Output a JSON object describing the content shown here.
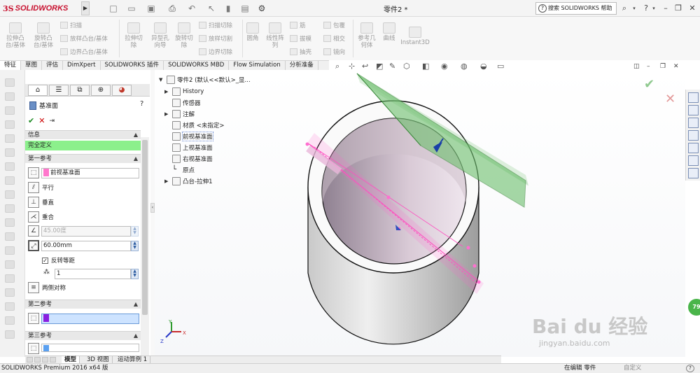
{
  "app": {
    "logo_text": "SOLIDWORKS",
    "logo_mark": "3S",
    "document_title": "零件2 *",
    "help_search": "搜索 SOLIDWORKS 帮助"
  },
  "ribbon": {
    "buttons": [
      {
        "label": "拉伸凸\n台/基体"
      },
      {
        "label": "旋转凸\n台/基体"
      },
      {
        "label": "拉伸切\n除"
      },
      {
        "label": "异型孔\n向导"
      },
      {
        "label": "旋转切\n除"
      },
      {
        "label": "圆角"
      },
      {
        "label": "线性阵\n列"
      },
      {
        "label": "参考几\n何体"
      },
      {
        "label": "曲线"
      },
      {
        "label": "Instant3D"
      }
    ],
    "small": [
      {
        "label": "扫描"
      },
      {
        "label": "放样凸台/基体"
      },
      {
        "label": "边界凸台/基体"
      },
      {
        "label": "扫描切除"
      },
      {
        "label": "放样切割"
      },
      {
        "label": "边界切除"
      },
      {
        "label": "筋"
      },
      {
        "label": "拔模"
      },
      {
        "label": "抽壳"
      },
      {
        "label": "包覆"
      },
      {
        "label": "相交"
      },
      {
        "label": "镜向"
      }
    ]
  },
  "tabs": [
    "特征",
    "草图",
    "评估",
    "DimXpert",
    "SOLIDWORKS 插件",
    "SOLIDWORKS MBD",
    "Flow Simulation",
    "分析准备"
  ],
  "property_manager": {
    "title": "基准面",
    "help": "?",
    "info_section": "信息",
    "status_message": "完全定义",
    "first_ref_section": "第一参考",
    "first_ref_value": "前视基准面",
    "options": {
      "parallel": "平行",
      "perpendicular": "垂直",
      "coincident": "重合"
    },
    "angle_value": "45.00度",
    "distance_value": "60.00mm",
    "flip_label": "反转等距",
    "count_value": "1",
    "symmetric_label": "两侧对称",
    "second_ref_section": "第二参考",
    "third_ref_section": "第三参考"
  },
  "tree": {
    "root": "零件2  (默认<<默认>_显...",
    "items": [
      {
        "label": "History"
      },
      {
        "label": "传感器"
      },
      {
        "label": "注解"
      },
      {
        "label": "材质 <未指定>"
      },
      {
        "label": "前视基准面"
      },
      {
        "label": "上视基准面"
      },
      {
        "label": "右视基准面"
      },
      {
        "label": "原点"
      },
      {
        "label": "凸台-拉伸1"
      }
    ]
  },
  "bottom_tabs": [
    "模型",
    "3D 视图",
    "运动算例 1"
  ],
  "status_bar": {
    "left": "SOLIDWORKS Premium 2016 x64 版",
    "mid": "在编辑 零件",
    "right": "自定义"
  },
  "badge": "79",
  "watermark": {
    "main": "Bai du 经验",
    "sub": "jingyan.baidu.com"
  },
  "triad": {
    "y": "Y",
    "x": "X",
    "z": "Z"
  },
  "colors": {
    "accent": "#c8102e",
    "status_green": "#8cf08c",
    "plane_green": "#6cbf6c",
    "preview_pink": "#ff66cc"
  }
}
